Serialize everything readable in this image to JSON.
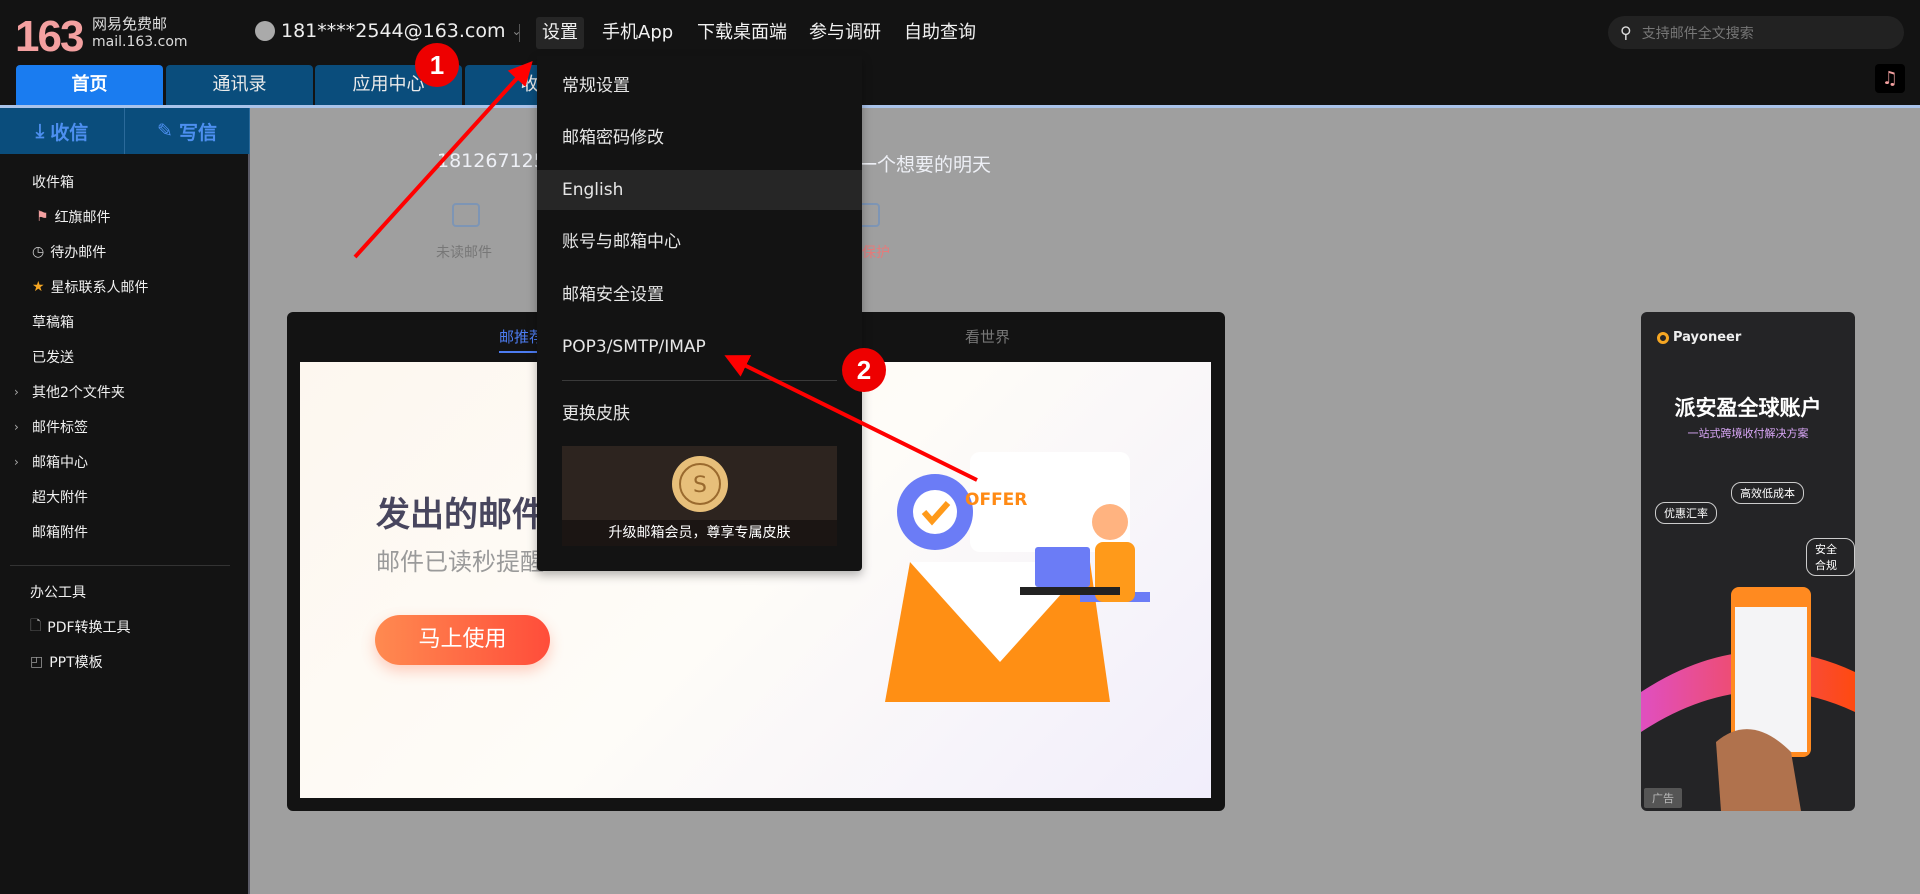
{
  "logo": {
    "number": "163",
    "name": "网易免费邮",
    "domain": "mail.163.com"
  },
  "account": {
    "email": "181****2544@163.com"
  },
  "nav": [
    "设置",
    "手机App",
    "下载桌面端",
    "参与调研",
    "自助查询"
  ],
  "search": {
    "placeholder": "支持邮件全文搜索"
  },
  "tabs": [
    "首页",
    "通讯录",
    "应用中心",
    "收信"
  ],
  "sidebar": {
    "receive": "收信",
    "compose": "写信",
    "items": [
      {
        "label": "收件箱",
        "icon": ""
      },
      {
        "label": "红旗邮件",
        "icon": "flag-icon"
      },
      {
        "label": "待办邮件",
        "icon": "clock-icon"
      },
      {
        "label": "星标联系人邮件",
        "icon": "star-icon"
      },
      {
        "label": "草稿箱",
        "icon": ""
      },
      {
        "label": "已发送",
        "icon": ""
      },
      {
        "label": "其他2个文件夹",
        "icon": "chevron-right-icon"
      },
      {
        "label": "邮件标签",
        "icon": "chevron-right-icon"
      },
      {
        "label": "邮箱中心",
        "icon": "chevron-right-icon"
      },
      {
        "label": "超大附件",
        "icon": ""
      },
      {
        "label": "邮箱附件",
        "icon": ""
      }
    ],
    "tools_title": "办公工具",
    "tools": [
      "PDF转换工具",
      "PPT模板"
    ]
  },
  "home": {
    "welcome_left": "181267125",
    "welcome_right": "一个想要的明天",
    "quick": [
      {
        "label": "未读邮件"
      },
      {
        "label": "保护"
      }
    ],
    "card_tabs": [
      "邮推荐",
      "看世界"
    ],
    "banner": {
      "heading": "发出的邮件，",
      "sub": "邮件已读秒提醒",
      "button": "马上使用",
      "offer": "OFFER"
    }
  },
  "ad": {
    "brand": "Payoneer",
    "title": "派安盈全球账户",
    "subtitle": "一站式跨境收付解决方案",
    "bubbles": [
      "高效低成本",
      "优惠汇率",
      "安全合规"
    ],
    "tag": "广告"
  },
  "settings_menu": {
    "items": [
      "常规设置",
      "邮箱密码修改",
      "English",
      "账号与邮箱中心",
      "邮箱安全设置",
      "POP3/SMTP/IMAP",
      "更换皮肤"
    ],
    "highlighted": "English",
    "skin_promo": "升级邮箱会员，尊享专属皮肤"
  },
  "annotations": [
    "1",
    "2"
  ],
  "colors": {
    "accent": "#1a7cf0",
    "tab_bg": "#0a4d7c",
    "annotation": "#ff0000"
  }
}
